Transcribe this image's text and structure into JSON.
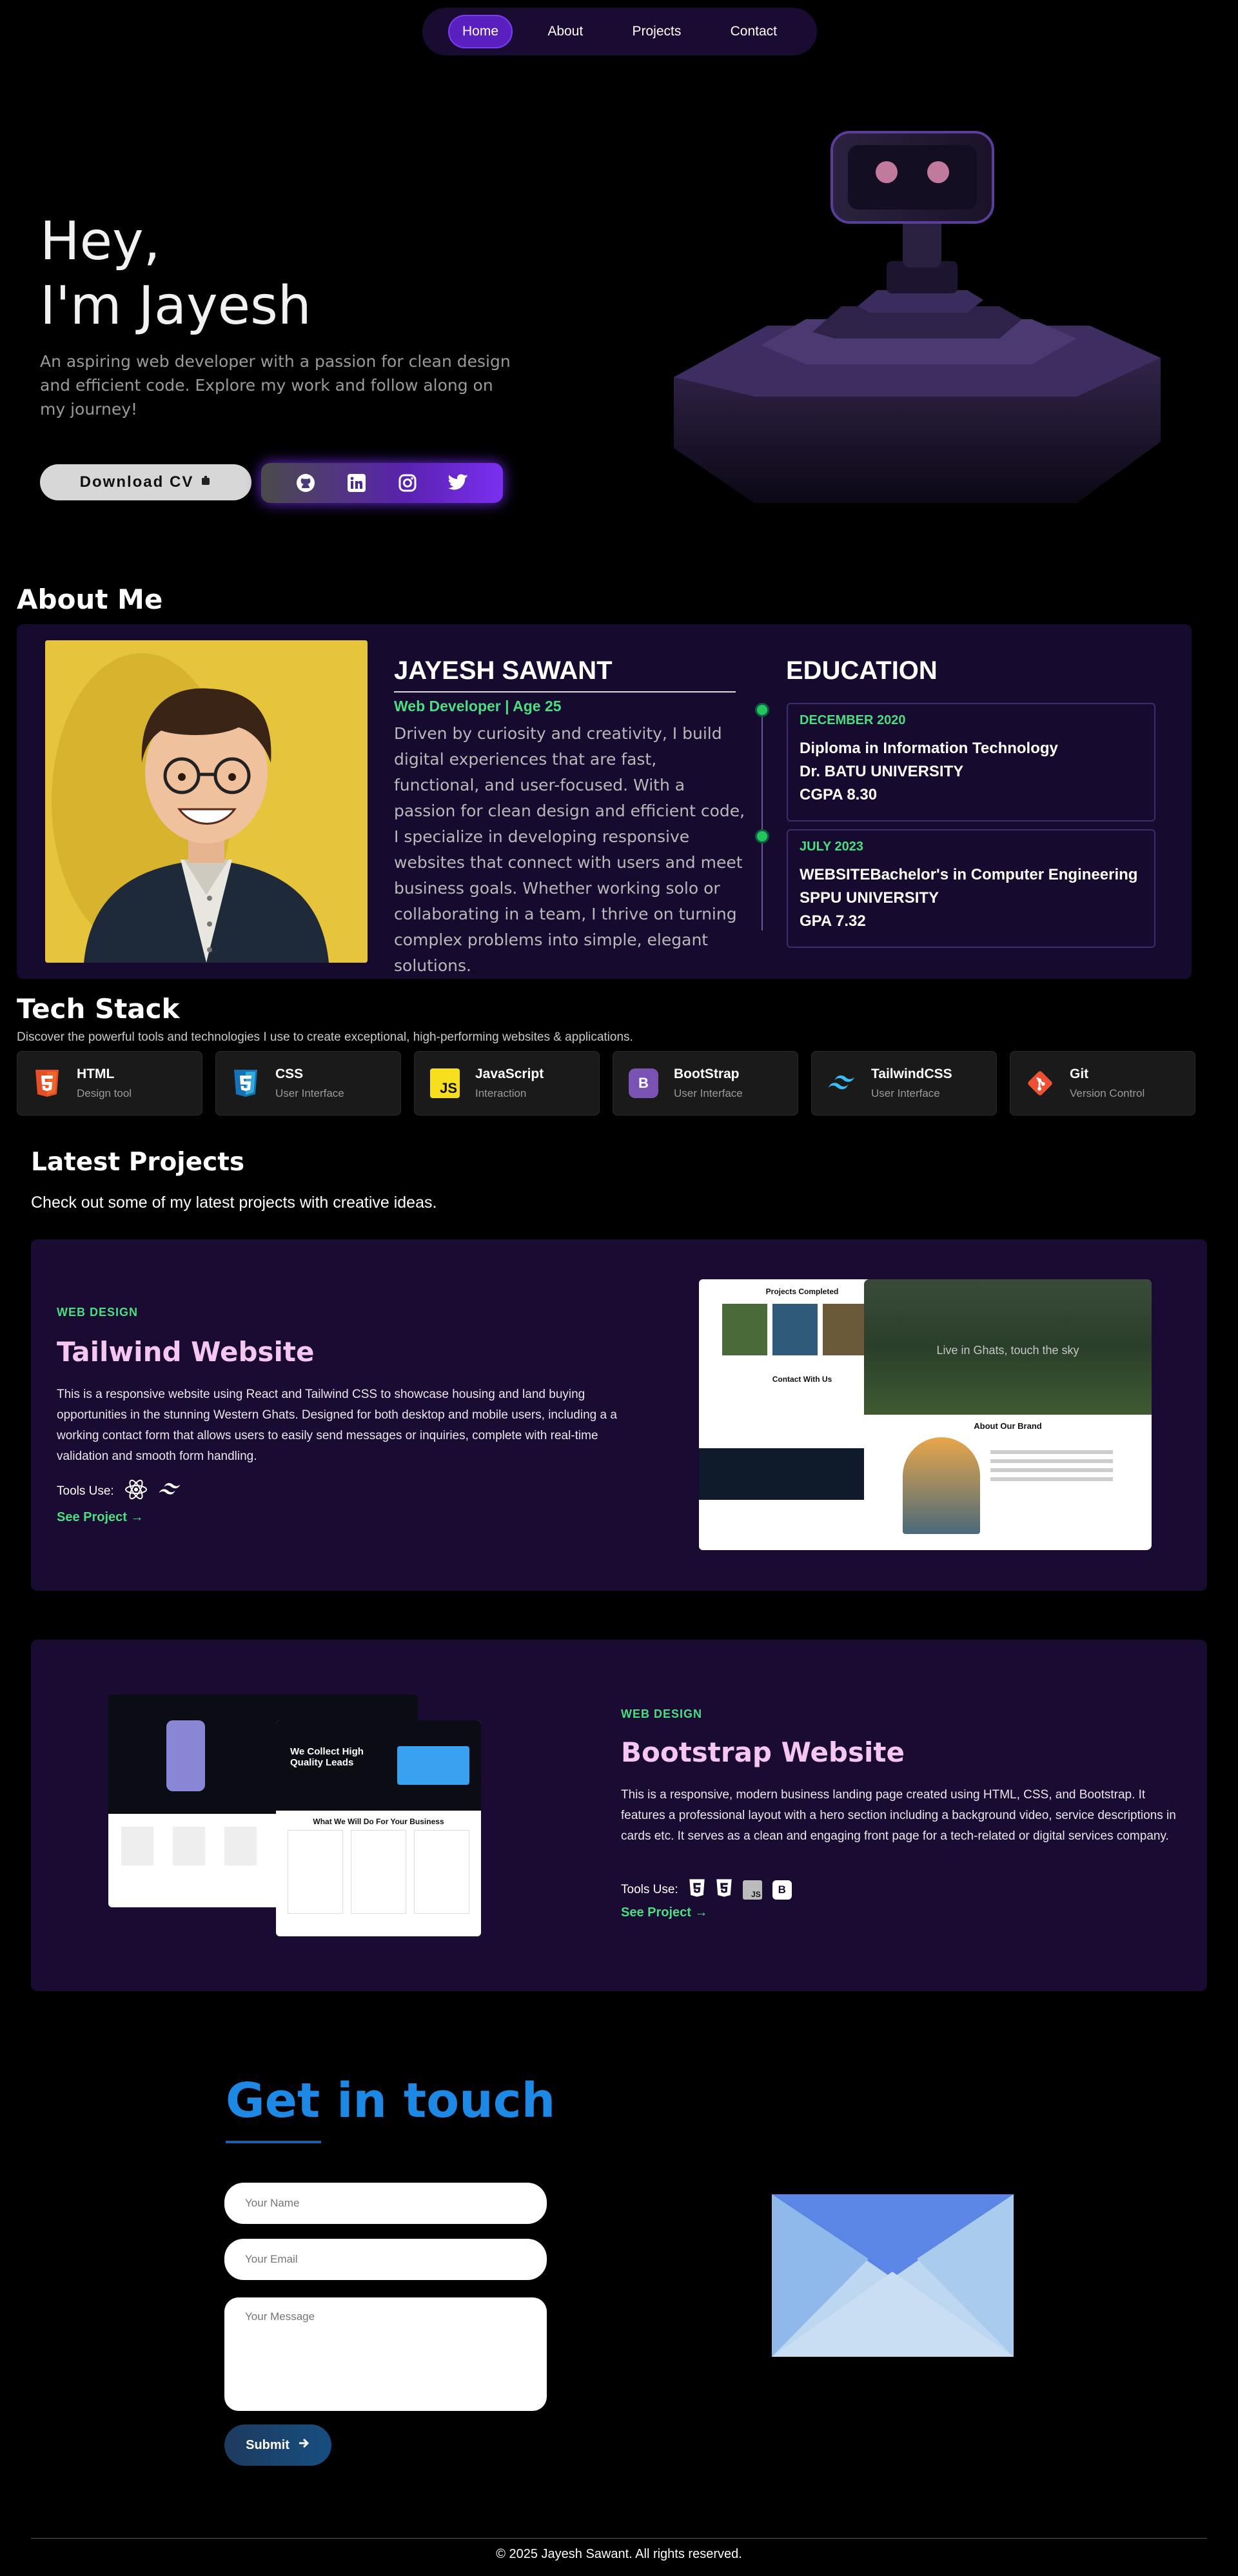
{
  "nav": {
    "items": [
      "Home",
      "About",
      "Projects",
      "Contact"
    ],
    "active": "Home"
  },
  "hero": {
    "greeting": "Hey,",
    "name_line": "I'm Jayesh",
    "description": "An aspiring web developer with a passion for clean design and efficient code. Explore my work and follow along on my journey!",
    "cv_label": "Download CV",
    "socials": [
      "github-icon",
      "linkedin-icon",
      "instagram-icon",
      "twitter-icon"
    ]
  },
  "about": {
    "section_title": "About Me",
    "name": "JAYESH SAWANT",
    "role": "Web Developer | Age 25",
    "bio": "Driven by curiosity and creativity, I build digital experiences that are fast, functional, and user-focused. With a passion for clean design and efficient code, I specialize in developing responsive websites that connect with users and meet business goals. Whether working solo or collaborating in a team, I thrive on turning complex problems into simple, elegant solutions.",
    "education_title": "EDUCATION",
    "education": [
      {
        "date": "DECEMBER 2020",
        "lines": [
          "Diploma in Information Technology",
          "Dr. BATU UNIVERSITY",
          "CGPA 8.30"
        ]
      },
      {
        "date": "JULY 2023",
        "lines": [
          "WEBSITEBachelor's in Computer Engineering",
          "SPPU UNIVERSITY",
          "GPA 7.32"
        ]
      }
    ]
  },
  "tech": {
    "section_title": "Tech Stack",
    "subtitle": "Discover the powerful tools and technologies I use to create exceptional, high-performing websites & applications.",
    "items": [
      {
        "name": "HTML",
        "desc": "Design tool",
        "icon": "html5-icon",
        "color": "#e34f26"
      },
      {
        "name": "CSS",
        "desc": "User Interface",
        "icon": "css3-icon",
        "color": "#1572b6"
      },
      {
        "name": "JavaScript",
        "desc": "Interaction",
        "icon": "javascript-icon",
        "color": "#f7df1e"
      },
      {
        "name": "BootStrap",
        "desc": "User Interface",
        "icon": "bootstrap-icon",
        "color": "#7952b3"
      },
      {
        "name": "TailwindCSS",
        "desc": "User Interface",
        "icon": "tailwind-icon",
        "color": "#38bdf8"
      },
      {
        "name": "Git",
        "desc": "Version Control",
        "icon": "git-icon",
        "color": "#f05032"
      }
    ]
  },
  "projects": {
    "section_title": "Latest Projects",
    "subtitle": "Check out some of my latest projects with creative ideas.",
    "items": [
      {
        "category": "WEB DESIGN",
        "title": "Tailwind Website",
        "description": "This is a responsive website using React and Tailwind CSS to showcase housing and land buying opportunities in the stunning Western Ghats. Designed for both desktop and mobile users, including a a working contact form that allows users to easily send messages or inquiries, complete with real-time validation and smooth form handling.",
        "tools_label": "Tools Use:",
        "link": "See Project →",
        "shot_headline": "Live in Ghats, touch the sky",
        "shot_section_a": "Projects Completed",
        "shot_section_b": "About Our Brand",
        "shot_contact": "Contact With Us"
      },
      {
        "category": "WEB DESIGN",
        "title": "Bootstrap Website",
        "description": "This is a responsive, modern business landing page created using HTML, CSS, and Bootstrap. It features a professional layout with a hero section including a background video, service descriptions in cards etc. It serves as a clean and engaging front page for a tech-related or digital services company.",
        "tools_label": "Tools Use:",
        "link": "See Project →",
        "shot_headline": "We Collect High Quality Leads",
        "shot_section": "What We Will Do For Your Business"
      }
    ]
  },
  "contact": {
    "title": "Get in touch",
    "name_placeholder": "Your Name",
    "email_placeholder": "Your Email",
    "message_placeholder": "Your Message",
    "submit_label": "Submit"
  },
  "footer": {
    "text": "© 2025 Jayesh Sawant. All rights reserved."
  }
}
